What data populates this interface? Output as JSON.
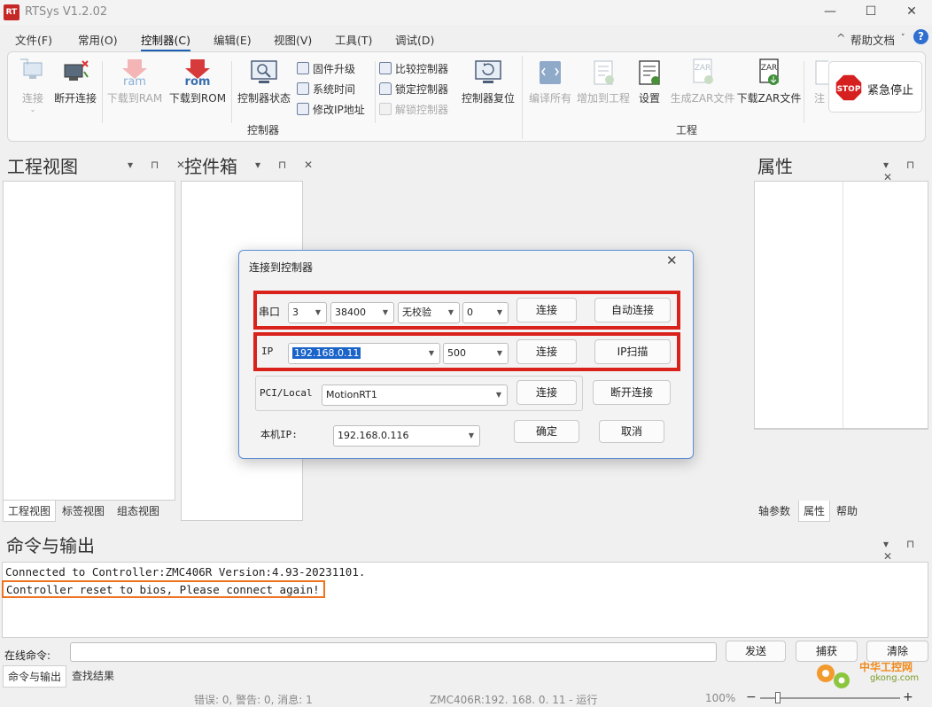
{
  "app": {
    "title": "RTSys V1.2.02",
    "icon": "RT"
  },
  "window": {
    "minimize": "—",
    "maximize": "☐",
    "close": "✕"
  },
  "menu": {
    "items": [
      "文件(F)",
      "常用(O)",
      "控制器(C)",
      "编辑(E)",
      "视图(V)",
      "工具(T)",
      "调试(D)"
    ],
    "help": "帮助文档",
    "help_icon": "?"
  },
  "ribbon": {
    "connect": "连接",
    "disconnect": "断开连接",
    "download_ram": "下载到RAM",
    "download_rom": "下载到ROM",
    "controller_state": "控制器状态",
    "firmware": "固件升级",
    "system_time": "系统时间",
    "modify_ip": "修改IP地址",
    "compare": "比较控制器",
    "lock": "锁定控制器",
    "unlock": "解锁控制器",
    "reset": "控制器复位",
    "group_controller": "控制器",
    "compile_all": "编译所有",
    "add_project": "增加到工程",
    "settings": "设置",
    "gen_zar": "生成ZAR文件",
    "download_zar": "下载ZAR文件",
    "note": "注",
    "group_project": "工程",
    "estop": "紧急停止",
    "stop_badge": "STOP",
    "ram_tag": "ram",
    "rom_tag": "rom",
    "zar_tag": "ZAR"
  },
  "panels": {
    "project_title": "工程视图",
    "toolbox_title": "控件箱",
    "props_title": "属性",
    "tools": "▾ ⊓ ✕",
    "project_tabs": [
      "工程视图",
      "标签视图",
      "组态视图"
    ],
    "props_tabs": [
      "轴参数",
      "属性",
      "帮助"
    ]
  },
  "dialog": {
    "title": "连接到控制器",
    "close": "✕",
    "serial_label": "串口",
    "serial_port": "3",
    "baud": "38400",
    "parity": "无校验",
    "stop": "0",
    "connect": "连接",
    "auto_connect": "自动连接",
    "ip_label": "IP",
    "ip_value": "192.168.0.11",
    "ip_port": "500",
    "ip_scan": "IP扫描",
    "pci_label": "PCI/Local",
    "pci_value": "MotionRT1",
    "disconnect": "断开连接",
    "local_ip_label": "本机IP:",
    "local_ip_value": "192.168.0.116",
    "ok": "确定",
    "cancel": "取消"
  },
  "output": {
    "title": "命令与输出",
    "lines": [
      "Connected to Controller:ZMC406R Version:4.93-20231101.",
      "Controller reset to bios, Please connect again!"
    ],
    "cmd_label": "在线命令:",
    "send": "发送",
    "capture": "捕获",
    "clear": "清除",
    "tabs": [
      "命令与输出",
      "查找结果"
    ]
  },
  "status": {
    "msg": "错误: 0, 警告: 0, 消息: 1",
    "controller": "ZMC406R:192. 168. 0. 11 - 运行",
    "zoom": "100%",
    "minus": "−",
    "plus": "+"
  },
  "watermark": {
    "cn": "中华工控网",
    "url": "gkong.com"
  }
}
